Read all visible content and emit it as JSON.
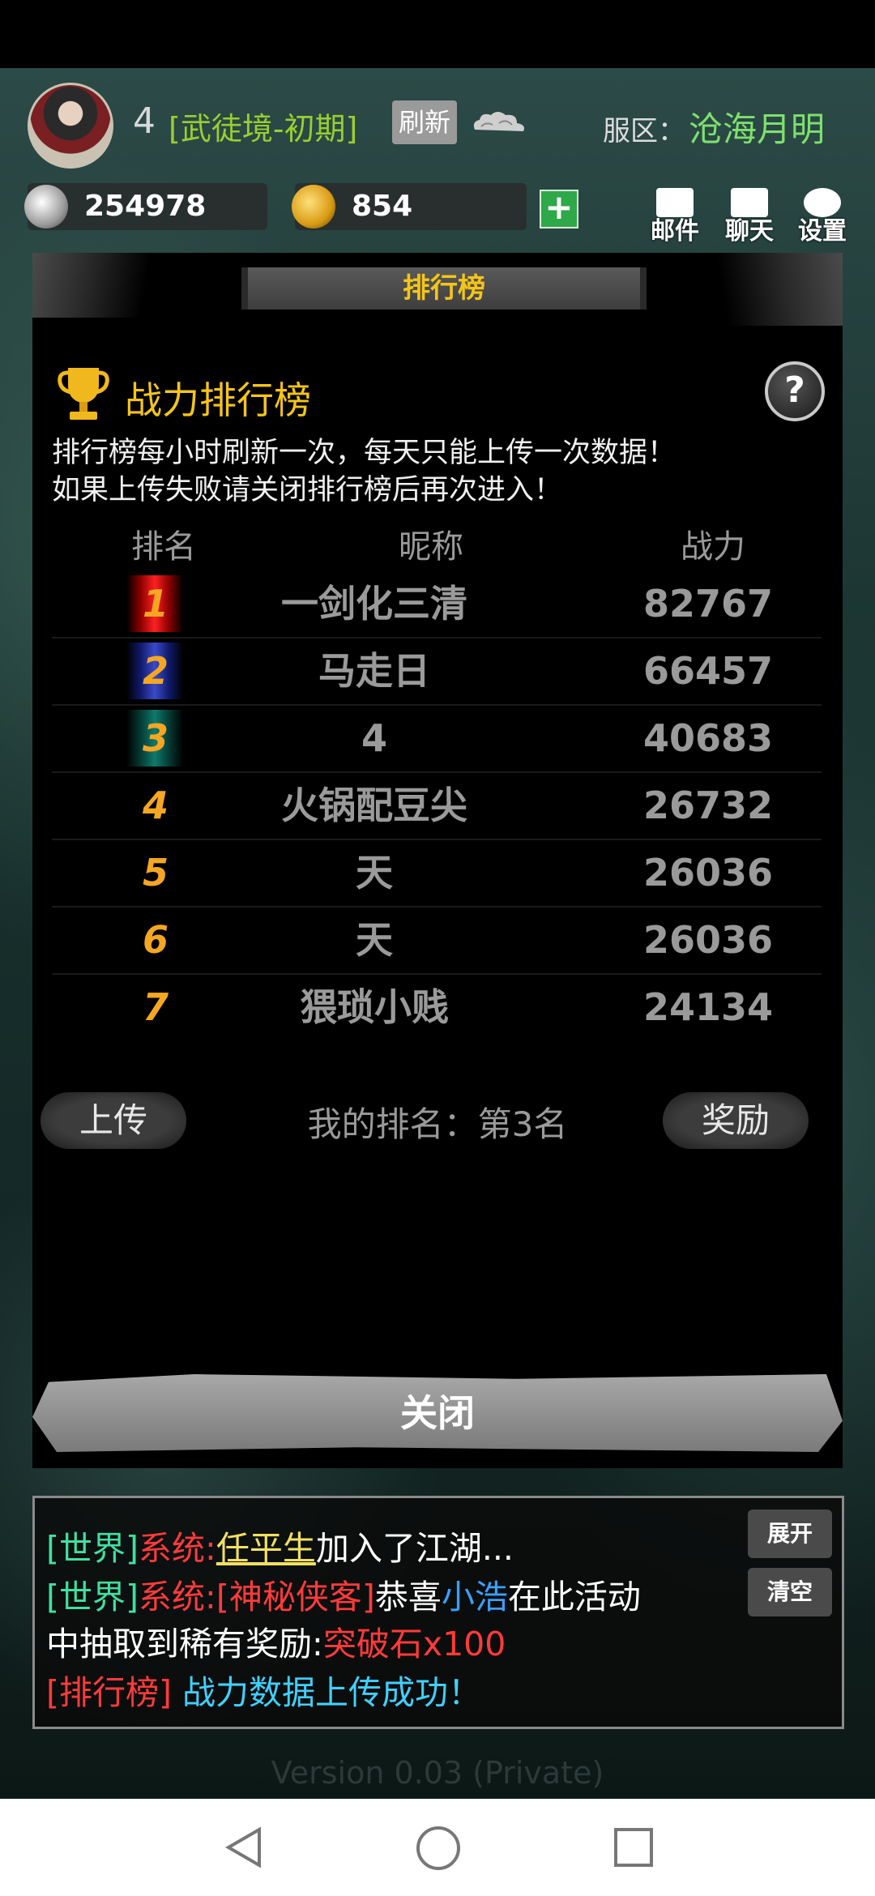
{
  "player": {
    "level": "4",
    "realm": "[武徒境-初期]",
    "refresh_label": "刷新"
  },
  "server": {
    "label": "服区：",
    "name": "沧海月明"
  },
  "currency": {
    "silver": "254978",
    "gold": "854"
  },
  "top_buttons": {
    "mail": "邮件",
    "chat": "聊天",
    "settings": "设置"
  },
  "panel": {
    "title": "排行榜",
    "subtitle": "战力排行榜",
    "help": "?",
    "notice_lines": [
      "排行榜每小时刷新一次，每天只能上传一次数据！",
      "如果上传失败请关闭排行榜后再次进入！"
    ],
    "columns": {
      "rank": "排名",
      "name": "昵称",
      "power": "战力"
    },
    "rows": [
      {
        "rank": "1",
        "name": "一剑化三清",
        "power": "82767"
      },
      {
        "rank": "2",
        "name": "马走日",
        "power": "66457"
      },
      {
        "rank": "3",
        "name": "4",
        "power": "40683"
      },
      {
        "rank": "4",
        "name": "火锅配豆尖",
        "power": "26732"
      },
      {
        "rank": "5",
        "name": "天",
        "power": "26036"
      },
      {
        "rank": "6",
        "name": "天",
        "power": "26036"
      },
      {
        "rank": "7",
        "name": "猥琐小贱",
        "power": "24134"
      }
    ],
    "upload_label": "上传",
    "my_rank": "我的排名：第3名",
    "reward_label": "奖励",
    "close_label": "关闭"
  },
  "chat": {
    "expand_label": "展开",
    "clear_label": "清空",
    "line1": {
      "channel": "[世界]",
      "sender": "系统:",
      "name": "任平生",
      "text": "加入了江湖..."
    },
    "line2": {
      "channel": "[世界]",
      "sender": "系统:",
      "name": "[神秘侠客]",
      "text1": "恭喜",
      "player": "小浩",
      "text2": "在此活动"
    },
    "line3": {
      "text": "中抽取到稀有奖励:",
      "item": "突破石x100"
    },
    "line4": {
      "channel": "[排行榜]",
      "text": " 战力数据上传成功！"
    }
  },
  "version": "Version 0.03 (Private)",
  "colors": {
    "accent_gold": "#f5c518",
    "rank_orange": "#f5a623",
    "realm_green": "#9acd32",
    "server_green": "#7ee06d"
  }
}
